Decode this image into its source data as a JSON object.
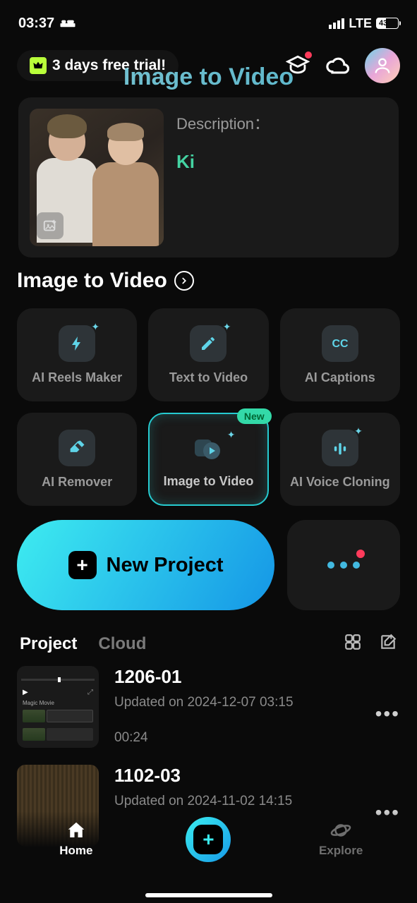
{
  "status": {
    "time": "03:37",
    "network": "LTE",
    "battery_pct": "43"
  },
  "header": {
    "trial_text": "3 days free trial!"
  },
  "banner": {
    "bg_title": "Image to Video",
    "desc_label": "Description：",
    "desc_value": "Ki"
  },
  "section_title": "Image to Video",
  "tools": [
    {
      "label": "AI Reels Maker",
      "icon": "bolt"
    },
    {
      "label": "Text  to Video",
      "icon": "pencil"
    },
    {
      "label": "AI Captions",
      "icon": "cc"
    },
    {
      "label": "AI Remover",
      "icon": "eraser"
    },
    {
      "label": "Image to Video",
      "icon": "gallery",
      "highlight": true,
      "badge": "New"
    },
    {
      "label": "AI Voice Cloning",
      "icon": "voice"
    }
  ],
  "new_project_label": "New Project",
  "tabs": {
    "project": "Project",
    "cloud": "Cloud"
  },
  "projects": [
    {
      "name": "1206-01",
      "updated": "Updated on 2024-12-07 03:15",
      "duration": "00:24"
    },
    {
      "name": "1102-03",
      "updated": "Updated on 2024-11-02 14:15",
      "duration": ""
    }
  ],
  "nav": {
    "home": "Home",
    "explore": "Explore"
  }
}
